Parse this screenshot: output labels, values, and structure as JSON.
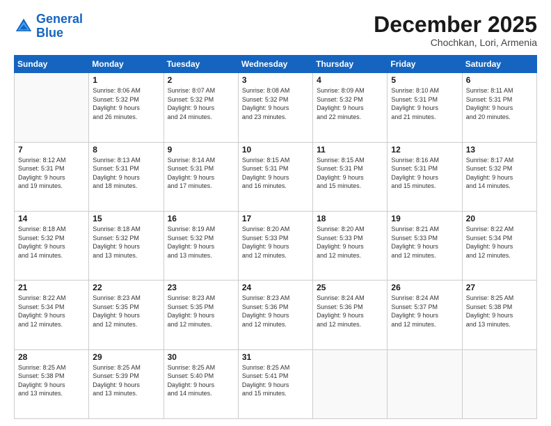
{
  "logo": {
    "line1": "General",
    "line2": "Blue"
  },
  "header": {
    "month": "December 2025",
    "location": "Chochkan, Lori, Armenia"
  },
  "weekdays": [
    "Sunday",
    "Monday",
    "Tuesday",
    "Wednesday",
    "Thursday",
    "Friday",
    "Saturday"
  ],
  "weeks": [
    [
      {
        "day": "",
        "info": ""
      },
      {
        "day": "1",
        "info": "Sunrise: 8:06 AM\nSunset: 5:32 PM\nDaylight: 9 hours\nand 26 minutes."
      },
      {
        "day": "2",
        "info": "Sunrise: 8:07 AM\nSunset: 5:32 PM\nDaylight: 9 hours\nand 24 minutes."
      },
      {
        "day": "3",
        "info": "Sunrise: 8:08 AM\nSunset: 5:32 PM\nDaylight: 9 hours\nand 23 minutes."
      },
      {
        "day": "4",
        "info": "Sunrise: 8:09 AM\nSunset: 5:32 PM\nDaylight: 9 hours\nand 22 minutes."
      },
      {
        "day": "5",
        "info": "Sunrise: 8:10 AM\nSunset: 5:31 PM\nDaylight: 9 hours\nand 21 minutes."
      },
      {
        "day": "6",
        "info": "Sunrise: 8:11 AM\nSunset: 5:31 PM\nDaylight: 9 hours\nand 20 minutes."
      }
    ],
    [
      {
        "day": "7",
        "info": "Sunrise: 8:12 AM\nSunset: 5:31 PM\nDaylight: 9 hours\nand 19 minutes."
      },
      {
        "day": "8",
        "info": "Sunrise: 8:13 AM\nSunset: 5:31 PM\nDaylight: 9 hours\nand 18 minutes."
      },
      {
        "day": "9",
        "info": "Sunrise: 8:14 AM\nSunset: 5:31 PM\nDaylight: 9 hours\nand 17 minutes."
      },
      {
        "day": "10",
        "info": "Sunrise: 8:15 AM\nSunset: 5:31 PM\nDaylight: 9 hours\nand 16 minutes."
      },
      {
        "day": "11",
        "info": "Sunrise: 8:15 AM\nSunset: 5:31 PM\nDaylight: 9 hours\nand 15 minutes."
      },
      {
        "day": "12",
        "info": "Sunrise: 8:16 AM\nSunset: 5:31 PM\nDaylight: 9 hours\nand 15 minutes."
      },
      {
        "day": "13",
        "info": "Sunrise: 8:17 AM\nSunset: 5:32 PM\nDaylight: 9 hours\nand 14 minutes."
      }
    ],
    [
      {
        "day": "14",
        "info": "Sunrise: 8:18 AM\nSunset: 5:32 PM\nDaylight: 9 hours\nand 14 minutes."
      },
      {
        "day": "15",
        "info": "Sunrise: 8:18 AM\nSunset: 5:32 PM\nDaylight: 9 hours\nand 13 minutes."
      },
      {
        "day": "16",
        "info": "Sunrise: 8:19 AM\nSunset: 5:32 PM\nDaylight: 9 hours\nand 13 minutes."
      },
      {
        "day": "17",
        "info": "Sunrise: 8:20 AM\nSunset: 5:33 PM\nDaylight: 9 hours\nand 12 minutes."
      },
      {
        "day": "18",
        "info": "Sunrise: 8:20 AM\nSunset: 5:33 PM\nDaylight: 9 hours\nand 12 minutes."
      },
      {
        "day": "19",
        "info": "Sunrise: 8:21 AM\nSunset: 5:33 PM\nDaylight: 9 hours\nand 12 minutes."
      },
      {
        "day": "20",
        "info": "Sunrise: 8:22 AM\nSunset: 5:34 PM\nDaylight: 9 hours\nand 12 minutes."
      }
    ],
    [
      {
        "day": "21",
        "info": "Sunrise: 8:22 AM\nSunset: 5:34 PM\nDaylight: 9 hours\nand 12 minutes."
      },
      {
        "day": "22",
        "info": "Sunrise: 8:23 AM\nSunset: 5:35 PM\nDaylight: 9 hours\nand 12 minutes."
      },
      {
        "day": "23",
        "info": "Sunrise: 8:23 AM\nSunset: 5:35 PM\nDaylight: 9 hours\nand 12 minutes."
      },
      {
        "day": "24",
        "info": "Sunrise: 8:23 AM\nSunset: 5:36 PM\nDaylight: 9 hours\nand 12 minutes."
      },
      {
        "day": "25",
        "info": "Sunrise: 8:24 AM\nSunset: 5:36 PM\nDaylight: 9 hours\nand 12 minutes."
      },
      {
        "day": "26",
        "info": "Sunrise: 8:24 AM\nSunset: 5:37 PM\nDaylight: 9 hours\nand 12 minutes."
      },
      {
        "day": "27",
        "info": "Sunrise: 8:25 AM\nSunset: 5:38 PM\nDaylight: 9 hours\nand 13 minutes."
      }
    ],
    [
      {
        "day": "28",
        "info": "Sunrise: 8:25 AM\nSunset: 5:38 PM\nDaylight: 9 hours\nand 13 minutes."
      },
      {
        "day": "29",
        "info": "Sunrise: 8:25 AM\nSunset: 5:39 PM\nDaylight: 9 hours\nand 13 minutes."
      },
      {
        "day": "30",
        "info": "Sunrise: 8:25 AM\nSunset: 5:40 PM\nDaylight: 9 hours\nand 14 minutes."
      },
      {
        "day": "31",
        "info": "Sunrise: 8:25 AM\nSunset: 5:41 PM\nDaylight: 9 hours\nand 15 minutes."
      },
      {
        "day": "",
        "info": ""
      },
      {
        "day": "",
        "info": ""
      },
      {
        "day": "",
        "info": ""
      }
    ]
  ]
}
